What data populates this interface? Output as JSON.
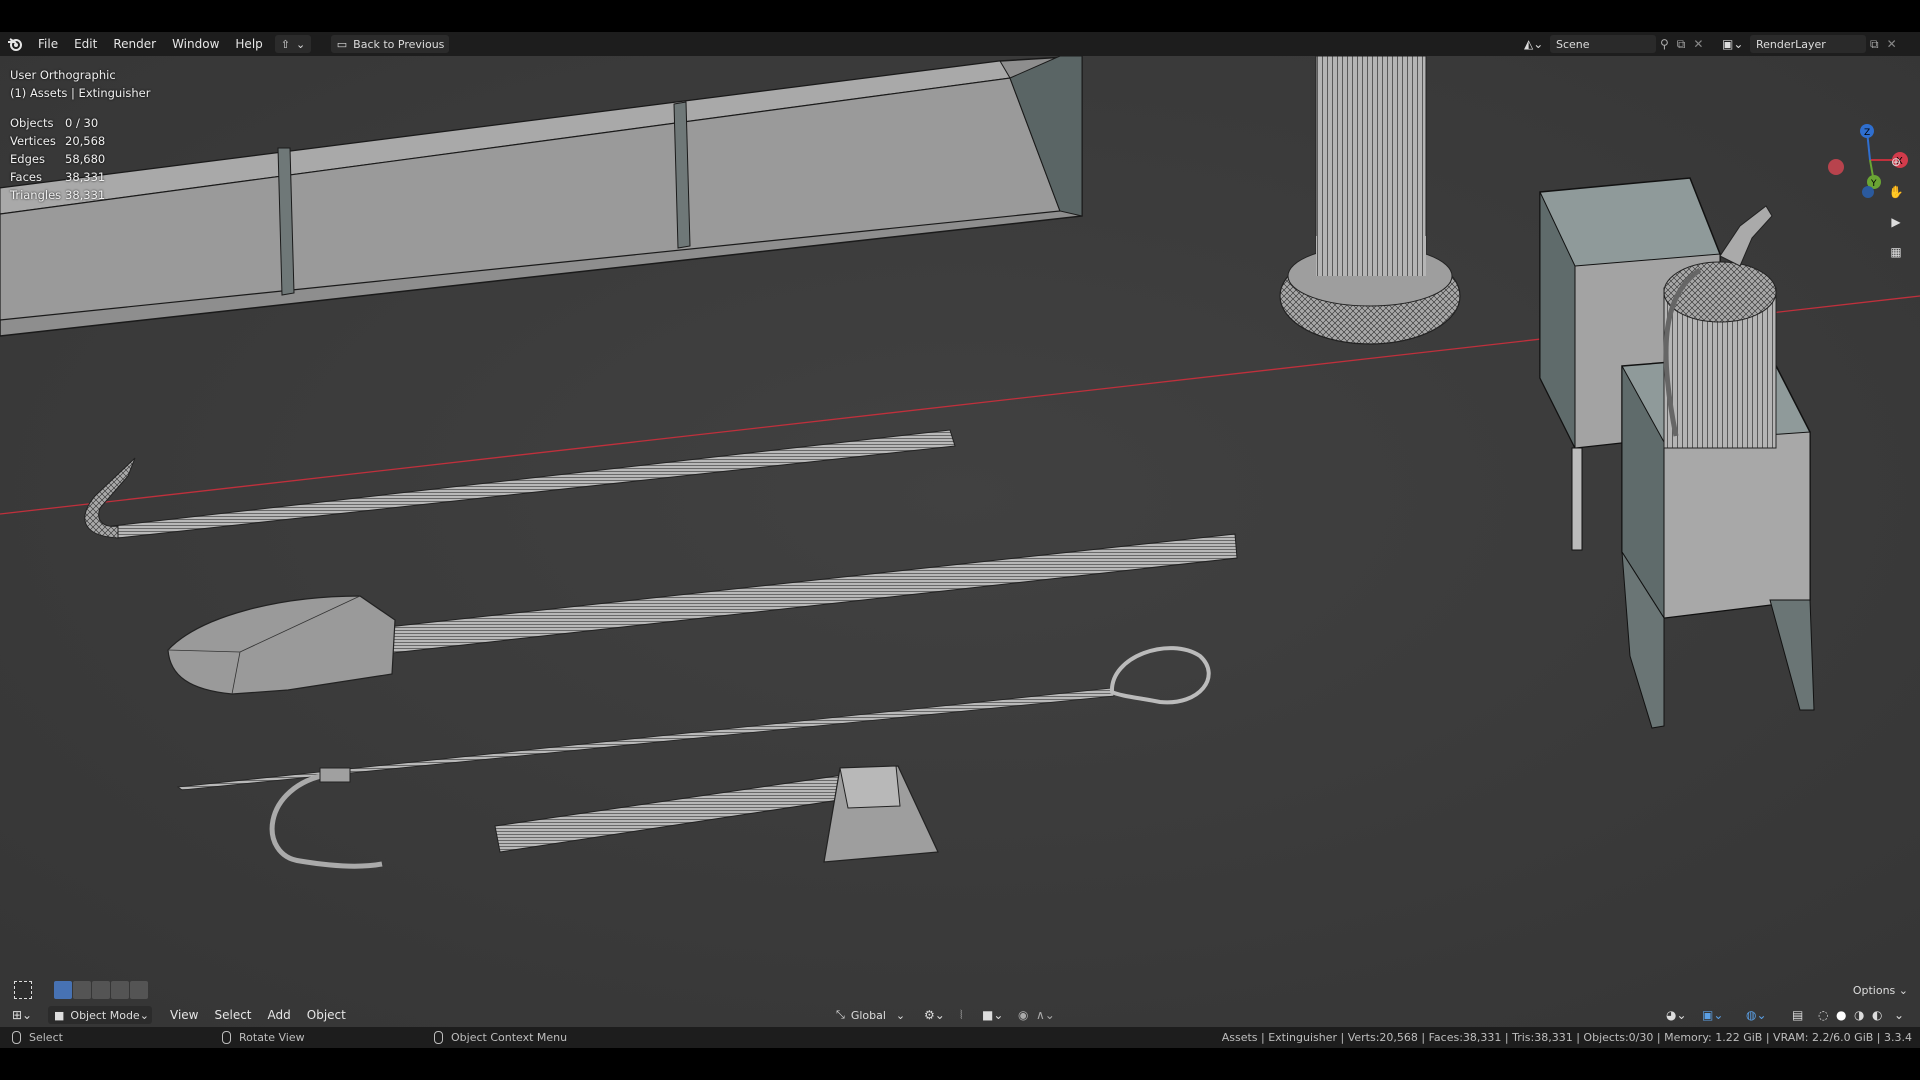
{
  "topbar": {
    "menu": [
      "File",
      "Edit",
      "Render",
      "Window",
      "Help"
    ],
    "back_label": "Back to Previous",
    "scene_value": "Scene",
    "renderlayer_value": "RenderLayer"
  },
  "viewport": {
    "view_name": "User Orthographic",
    "collection_label": "(1) Assets | Extinguisher",
    "stats": [
      {
        "label": "Objects",
        "value": "0 / 30"
      },
      {
        "label": "Vertices",
        "value": "20,568"
      },
      {
        "label": "Edges",
        "value": "58,680"
      },
      {
        "label": "Faces",
        "value": "38,331"
      },
      {
        "label": "Triangles",
        "value": "38,331"
      }
    ],
    "gizmo": {
      "x_label": "X",
      "y_label": "Y",
      "z_label": "Z"
    },
    "options_label": "Options"
  },
  "header": {
    "mode": "Object Mode",
    "menu": [
      "View",
      "Select",
      "Add",
      "Object"
    ],
    "orientation": "Global"
  },
  "statusbar": {
    "select_hint": "Select",
    "rotate_hint": "Rotate View",
    "context_hint": "Object Context Menu",
    "info": "Assets | Extinguisher | Verts:20,568 | Faces:38,331 | Tris:38,331 | Objects:0/30 | Memory: 1.22 GiB | VRAM: 2.2/6.0 GiB | 3.3.4"
  },
  "colors": {
    "viewport_bg": "#3d3d3d",
    "header_bg": "#1d1d1d",
    "accent_blue": "#4772b3",
    "axis_red": "#c0303c"
  }
}
